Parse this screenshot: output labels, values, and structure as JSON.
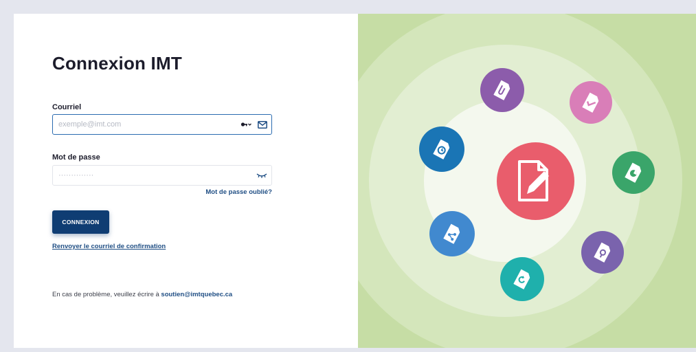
{
  "login": {
    "title": "Connexion IMT",
    "email_label": "Courriel",
    "email_placeholder": "exemple@imt.com",
    "password_label": "Mot de passe",
    "password_placeholder": "··············",
    "forgot_link": "Mot de passe oublié?",
    "submit_label": "CONNEXION",
    "resend_link": "Renvoyer le courriel de confirmation",
    "help_text": "En cas de problème, veuillez écrire à",
    "help_email": "soutien@imtquebec.ca"
  },
  "illustration": {
    "center_icon": "document-edit-icon",
    "satellite_icons": [
      {
        "name": "document-clip-icon",
        "color": "#8c5cab"
      },
      {
        "name": "document-check-icon",
        "color": "#d97eb8"
      },
      {
        "name": "document-pie-chart-icon",
        "color": "#3aa56a"
      },
      {
        "name": "document-search-icon",
        "color": "#7a63ad"
      },
      {
        "name": "document-refresh-icon",
        "color": "#1fb0ac"
      },
      {
        "name": "document-share-icon",
        "color": "#4189cf"
      },
      {
        "name": "document-clock-icon",
        "color": "#1a75b5"
      }
    ],
    "center_color": "#e95d6c",
    "background_color": "#c6dda5"
  }
}
